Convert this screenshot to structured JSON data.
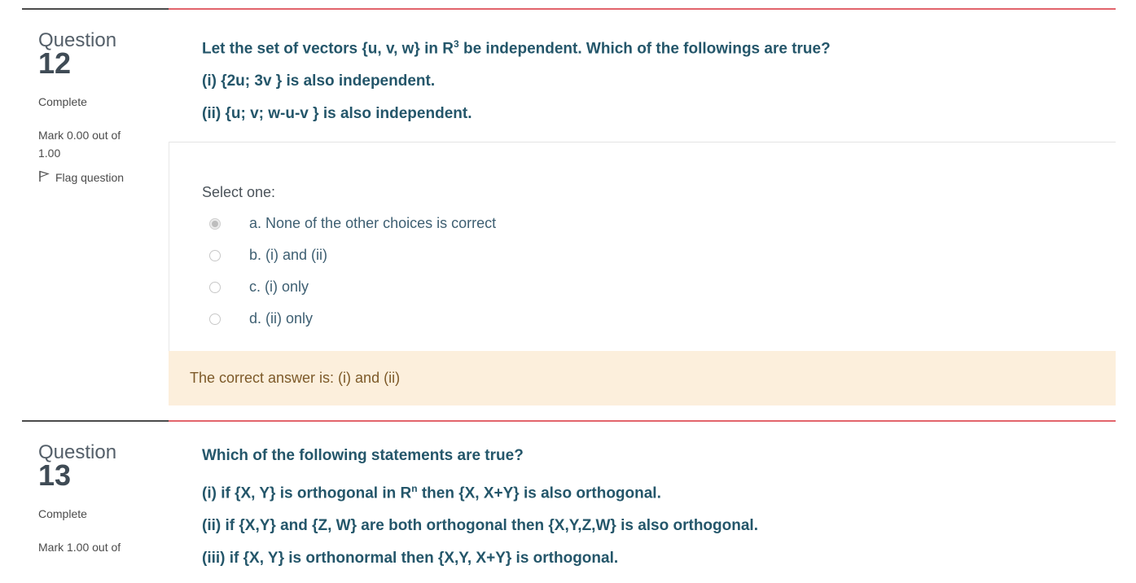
{
  "q12": {
    "word": "Question",
    "number": "12",
    "state": "Complete",
    "grade_line1": "Mark 0.00 out of",
    "grade_line2": "1.00",
    "flag_label": "Flag question",
    "text_line1_a": "Let the set of vectors {u, v, w} in R",
    "text_line1_sup": "3",
    "text_line1_b": " be independent. Which of the followings are true?",
    "text_line2": "(i) {2u; 3v } is also independent.",
    "text_line3": "(ii) {u; v; w-u-v } is also independent.",
    "prompt": "Select one:",
    "options": [
      {
        "label": "a. None of the other choices is correct",
        "selected": true
      },
      {
        "label": "b. (i) and (ii)",
        "selected": false
      },
      {
        "label": "c. (i) only",
        "selected": false
      },
      {
        "label": "d. (ii) only",
        "selected": false
      }
    ],
    "feedback": "The correct answer is: (i) and (ii)"
  },
  "q13": {
    "word": "Question",
    "number": "13",
    "state": "Complete",
    "grade_line1": "Mark 1.00 out of",
    "text_line1": "Which of the following statements are true?",
    "text_line2_a": "(i) if {X, Y} is orthogonal in R",
    "text_line2_sup": "n",
    "text_line2_b": " then {X, X+Y} is also orthogonal.",
    "text_line3": "(ii) if {X,Y} and {Z, W} are both orthogonal then {X,Y,Z,W} is also orthogonal.",
    "text_line4": "(iii) if {X, Y} is orthonormal then {X,Y, X+Y} is orthogonal."
  },
  "colors": {
    "question_text": "#24566a",
    "content_rule": "#e2646b",
    "info_rule": "#4b4b4b",
    "feedback_bg": "#fcefdc",
    "feedback_text": "#7d5a29"
  },
  "icons": {
    "flag": "flag-icon",
    "radio": "radio-button"
  }
}
